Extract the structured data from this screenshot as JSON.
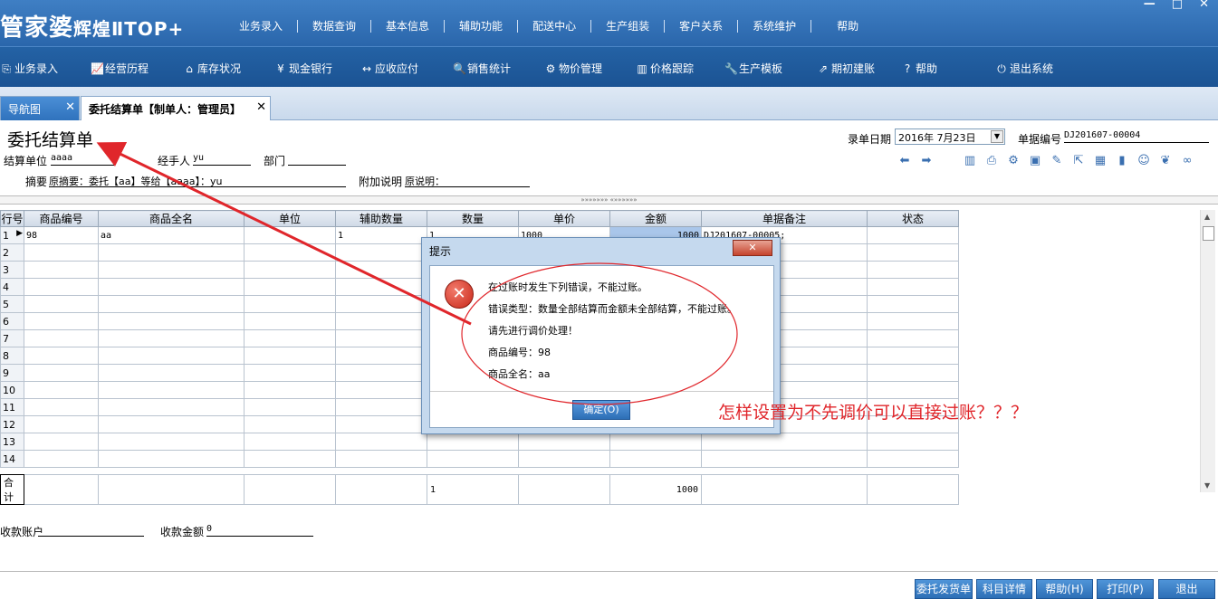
{
  "app": {
    "logo_main": "管家婆",
    "logo_sub": "辉煌ⅡTOP+",
    "menu": [
      "业务录入",
      "数据查询",
      "基本信息",
      "辅助功能",
      "配送中心",
      "生产组装",
      "客户关系",
      "系统维护",
      "帮助"
    ]
  },
  "toolbar": {
    "items": [
      "业务录入",
      "经营历程",
      "库存状况",
      "现金银行",
      "应收应付",
      "销售统计",
      "物价管理",
      "价格跟踪",
      "生产模板",
      "期初建账",
      "帮助",
      "退出系统"
    ]
  },
  "tabs": {
    "nav": "导航图",
    "doc": "委托结算单【制单人：管理员】"
  },
  "form": {
    "title": "委托结算单",
    "entry_date_label": "录单日期",
    "entry_date_value": "2016年 7月23日",
    "doc_no_label": "单据编号",
    "doc_no_value": "DJ201607-00004",
    "settle_unit_label": "结算单位",
    "settle_unit_value": "aaaa",
    "handler_label": "经手人",
    "handler_value": "yu",
    "dept_label": "部门",
    "dept_value": "",
    "summary_label": "摘要",
    "summary_value": "原摘要：委托【aa】等给【aaaa】：yu",
    "note_label": "附加说明",
    "note_value": "原说明：",
    "splitter_text": "»»»»»»» «»»»»»»"
  },
  "grid": {
    "headers": [
      "行号",
      "商品编号",
      "商品全名",
      "单位",
      "辅助数量",
      "数量",
      "单价",
      "金额",
      "单据备注",
      "状态"
    ],
    "rows": [
      [
        "1",
        "98",
        "aa",
        "",
        "1",
        "1",
        "1000",
        "1000",
        "DJ201607-00005;",
        ""
      ],
      [
        "2",
        "",
        "",
        "",
        "",
        "",
        "",
        "",
        "",
        ""
      ],
      [
        "3",
        "",
        "",
        "",
        "",
        "",
        "",
        "",
        "",
        ""
      ],
      [
        "4",
        "",
        "",
        "",
        "",
        "",
        "",
        "",
        "",
        ""
      ],
      [
        "5",
        "",
        "",
        "",
        "",
        "",
        "",
        "",
        "",
        ""
      ],
      [
        "6",
        "",
        "",
        "",
        "",
        "",
        "",
        "",
        "",
        ""
      ],
      [
        "7",
        "",
        "",
        "",
        "",
        "",
        "",
        "",
        "",
        ""
      ],
      [
        "8",
        "",
        "",
        "",
        "",
        "",
        "",
        "",
        "",
        ""
      ],
      [
        "9",
        "",
        "",
        "",
        "",
        "",
        "",
        "",
        "",
        ""
      ],
      [
        "10",
        "",
        "",
        "",
        "",
        "",
        "",
        "",
        "",
        ""
      ],
      [
        "11",
        "",
        "",
        "",
        "",
        "",
        "",
        "",
        "",
        ""
      ],
      [
        "12",
        "",
        "",
        "",
        "",
        "",
        "",
        "",
        "",
        ""
      ],
      [
        "13",
        "",
        "",
        "",
        "",
        "",
        "",
        "",
        "",
        ""
      ],
      [
        "14",
        "",
        "",
        "",
        "",
        "",
        "",
        "",
        "",
        ""
      ]
    ],
    "totals": [
      "合计",
      "",
      "",
      "",
      "",
      "1",
      "",
      "1000",
      "",
      ""
    ]
  },
  "footer": {
    "account_label": "收款账户",
    "account_value": "",
    "amount_label": "收款金额",
    "amount_value": "0",
    "buttons": [
      "委托发货单",
      "科目详情",
      "帮助(H)",
      "打印(P)",
      "退出"
    ]
  },
  "dialog": {
    "title": "提示",
    "lines": [
      "在过账时发生下列错误，不能过账。",
      "错误类型：数量全部结算而金额未全部结算，不能过账。",
      "请先进行调价处理！",
      "商品编号：98",
      "商品全名：aa"
    ],
    "ok_label": "确定(O)"
  },
  "annotation": {
    "question": "怎样设置为不先调价可以直接过账？？？",
    "color": "#e0262b"
  }
}
